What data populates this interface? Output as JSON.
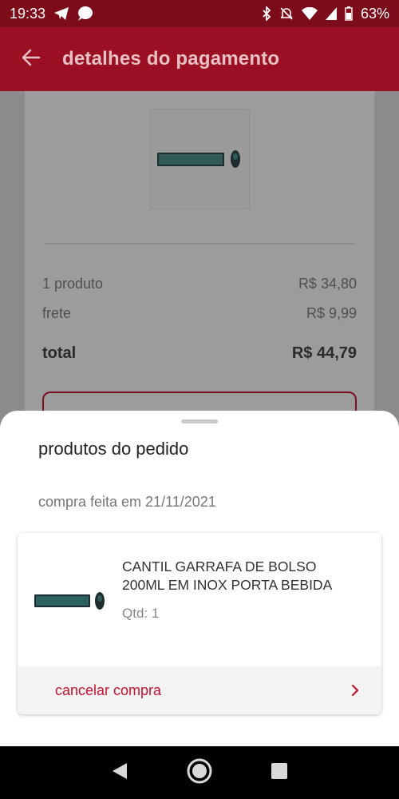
{
  "status_bar": {
    "time": "19:33",
    "battery": "63%"
  },
  "app_bar": {
    "title": "detalhes do pagamento"
  },
  "summary": {
    "products_label": "1 produto",
    "products_value": "R$ 34,80",
    "shipping_label": "frete",
    "shipping_value": "R$ 9,99",
    "total_label": "total",
    "total_value": "R$ 44,79"
  },
  "sheet": {
    "title": "produtos do pedido",
    "date": "compra feita em 21/11/2021",
    "product": {
      "name": "CANTIL GARRAFA DE BOLSO 200ML EM INOX PORTA BEBIDA",
      "qty": "Qtd: 1"
    },
    "cancel_label": "cancelar compra"
  },
  "colors": {
    "brand": "#9a0f22",
    "accent": "#c41230"
  }
}
